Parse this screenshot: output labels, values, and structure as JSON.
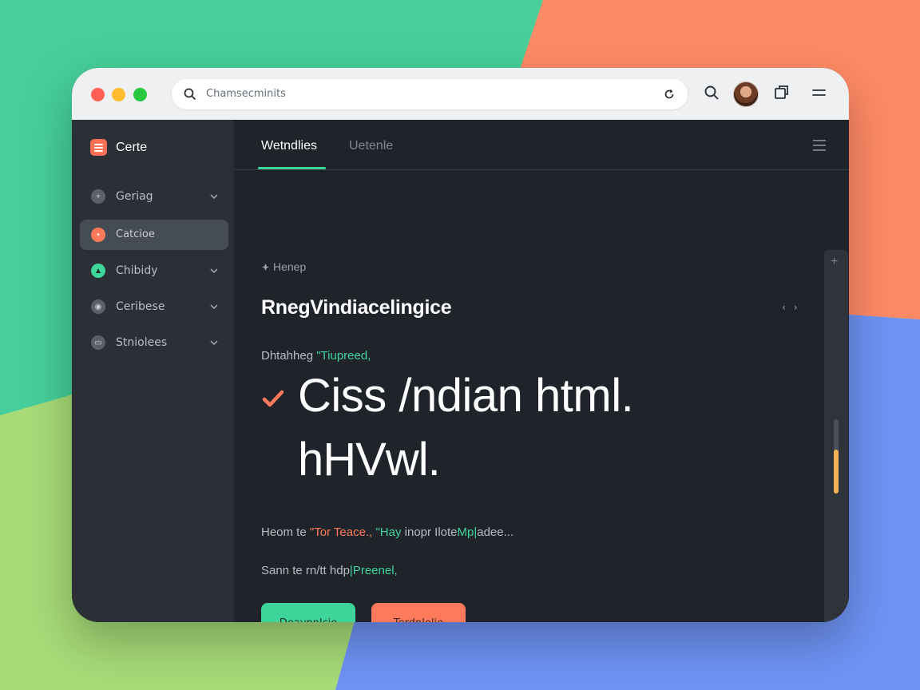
{
  "colors": {
    "accent_green": "#3ed59a",
    "accent_orange": "#ff7a5a",
    "scroll_thumb": "#f2b45a"
  },
  "browser": {
    "address_text": "Chamsecminits"
  },
  "sidebar": {
    "brand": "Certe",
    "items": [
      {
        "label": "Geriag",
        "icon": "plus-circle-icon",
        "has_chevron": true
      },
      {
        "label": "Catcioe",
        "icon": "circle-icon",
        "active": true,
        "has_chevron": false
      },
      {
        "label": "Chibidy",
        "icon": "triangle-icon",
        "has_chevron": true
      },
      {
        "label": "Ceribese",
        "icon": "camera-icon",
        "has_chevron": true
      },
      {
        "label": "Stniolees",
        "icon": "monitor-icon",
        "has_chevron": true
      }
    ]
  },
  "tabs": [
    {
      "label": "Wetndlies",
      "active": true
    },
    {
      "label": "Uetenle",
      "active": false
    }
  ],
  "content": {
    "breadcrumb": "Henep",
    "title": "RnegVindiacelingice",
    "subtitle_prefix": "Dhtahheg",
    "subtitle_highlight": "\"Tiupreed,",
    "hero_line1": "Ciss /ndian html.",
    "hero_line2": "hHVwl.",
    "line1_a": "Heom te",
    "line1_b": "\"Tor Teace.,",
    "line1_c": "\"Hay",
    "line1_d": "inopr Ilote",
    "line1_e": "Mp|",
    "line1_f": "adee...",
    "line2_a": "Sann te rn/tt hdp",
    "line2_b": "|Preenel,",
    "btn_primary": "Deaypnlcie",
    "btn_secondary": "Terdnlelie"
  }
}
